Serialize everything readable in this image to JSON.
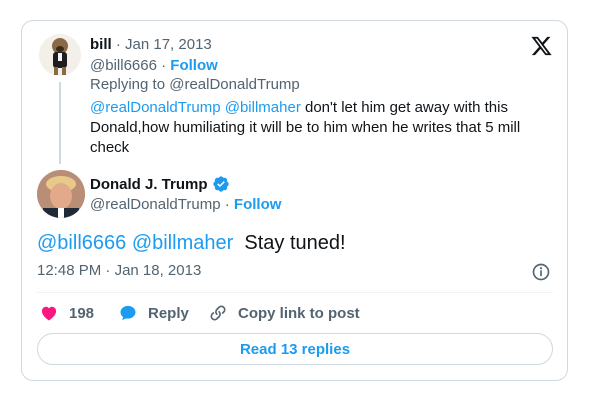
{
  "parent": {
    "name": "bill",
    "date": "Jan 17, 2013",
    "handle": "@bill6666",
    "follow": "Follow",
    "replying_prefix": "Replying to",
    "replying_to": "@realDonaldTrump",
    "mention1": "@realDonaldTrump",
    "mention2": "@billmaher",
    "text": "don't let him get away with this Donald,how humiliating it will be to him when he writes that 5 mill check"
  },
  "main": {
    "name": "Donald J. Trump",
    "handle": "@realDonaldTrump",
    "follow": "Follow",
    "mention1": "@bill6666",
    "mention2": "@billmaher",
    "text": "Stay tuned!",
    "time": "12:48 PM",
    "date": "Jan 18, 2013"
  },
  "actions": {
    "like_count": "198",
    "reply_label": "Reply",
    "copy_label": "Copy link to post"
  },
  "read_replies": "Read 13 replies",
  "colors": {
    "accent": "#1d9bf0",
    "like": "#f91880",
    "verified": "#1d9bf0"
  }
}
